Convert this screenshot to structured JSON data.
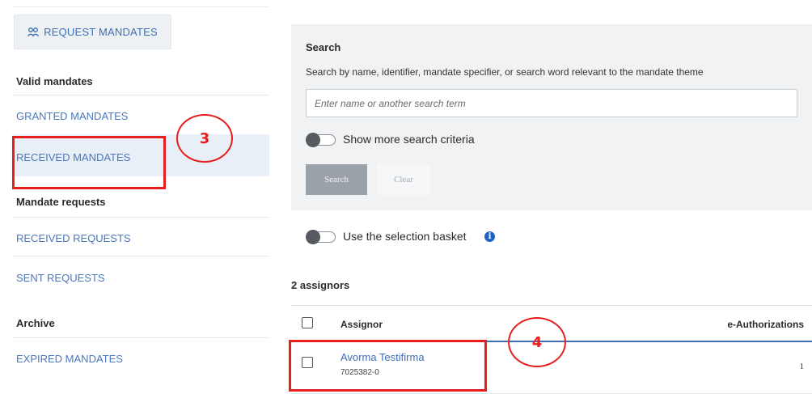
{
  "sidebar": {
    "request_button_label": "REQUEST MANDATES",
    "valid_heading": "Valid mandates",
    "granted_label": "GRANTED MANDATES",
    "received_label": "RECEIVED MANDATES",
    "requests_heading": "Mandate requests",
    "received_requests_label": "RECEIVED REQUESTS",
    "sent_requests_label": "SENT REQUESTS",
    "archive_heading": "Archive",
    "expired_label": "EXPIRED MANDATES"
  },
  "search": {
    "title": "Search",
    "description": "Search by name, identifier, mandate specifier, or search word relevant to the mandate theme",
    "placeholder": "Enter name or another search term",
    "more_criteria_label": "Show more search criteria",
    "more_criteria_on": false,
    "search_button": "Search",
    "clear_button": "Clear"
  },
  "basket": {
    "label": "Use the selection basket",
    "on": false
  },
  "results": {
    "count_label": "2 assignors",
    "columns": [
      "Assignor",
      "e-Authorizations"
    ],
    "rows": [
      {
        "name": "Avorma Testifirma",
        "id": "7025382-0",
        "authorizations": "1"
      }
    ]
  },
  "annotations": {
    "step3": "3",
    "step4": "4",
    "color": "#e61e1e"
  },
  "colors": {
    "accent": "#3f6fb6",
    "active_bg": "#e8eff7",
    "panel_bg": "#f0f2f4"
  }
}
